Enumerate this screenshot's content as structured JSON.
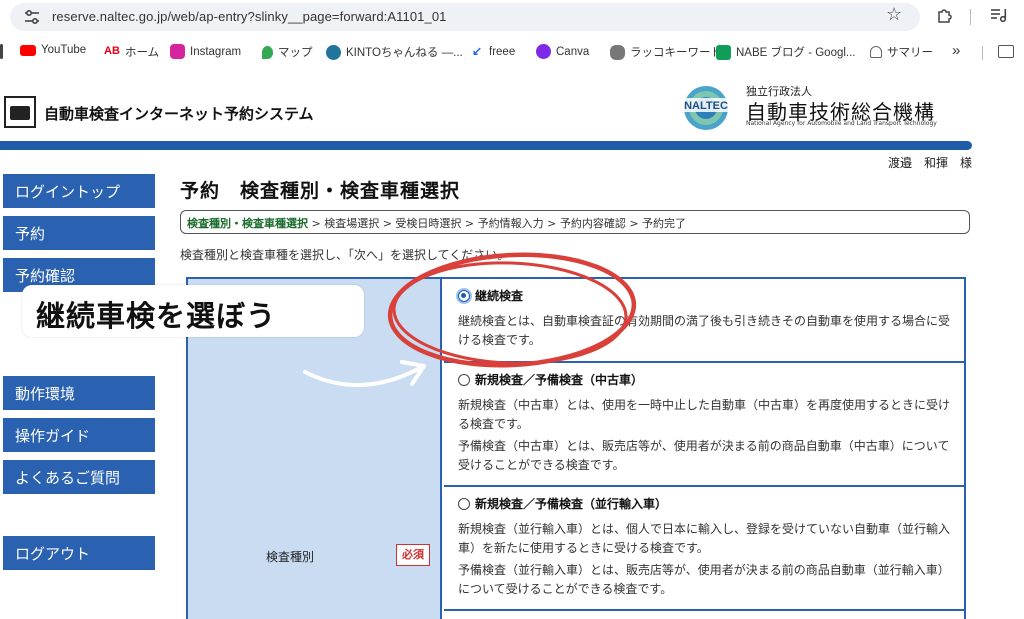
{
  "browser": {
    "url": "reserve.naltec.go.jp/web/ap-entry?slinky__page=forward:A1101_01",
    "bookmarks": [
      {
        "label": "YouTube",
        "icon": "youtube-icon",
        "color": "#ff0000"
      },
      {
        "label": "ホーム",
        "icon": "ab-logo-icon",
        "color": "#e60012"
      },
      {
        "label": "Instagram",
        "icon": "instagram-icon",
        "color": "#d6249f"
      },
      {
        "label": "マップ",
        "icon": "map-pin-icon",
        "color": "#34a853"
      },
      {
        "label": "KINTOちゃんねる —...",
        "icon": "wordpress-icon",
        "color": "#21759b"
      },
      {
        "label": "freee",
        "icon": "freee-icon",
        "color": "#2864f0"
      },
      {
        "label": "Canva",
        "icon": "canva-icon",
        "color": "#7d2ae8"
      },
      {
        "label": "ラッコキーワード",
        "icon": "rakko-icon",
        "color": "#444444"
      },
      {
        "label": "NABE ブログ - Googl...",
        "icon": "plus-icon",
        "color": "#0f9d58"
      },
      {
        "label": "サマリー",
        "icon": "summary-icon",
        "color": "#5f6368"
      }
    ],
    "more_label": "»"
  },
  "header": {
    "site_title": "自動車検査インターネット予約システム",
    "org_small": "独立行政法人",
    "org_big": "自動車技術総合機構",
    "org_en": "National Agency for Automobile and Land Transport Technology",
    "logo_text": "NALTEC",
    "user": "渡邉　和揮　様"
  },
  "sidebar": {
    "items": [
      {
        "label": "ログイントップ"
      },
      {
        "label": "予約"
      },
      {
        "label": "予約確認"
      },
      {
        "label": "動作環境"
      },
      {
        "label": "操作ガイド"
      },
      {
        "label": "よくあるご質問"
      },
      {
        "label": "ログアウト"
      }
    ]
  },
  "main": {
    "title": "予約　検査種別・検査車種選択",
    "steps": {
      "active": "検査種別・検査車種選択",
      "rest": " > 検査場選択 > 受検日時選択 > 予約情報入力 > 予約内容確認 > 予約完了"
    },
    "instructions": "検査種別と検査車種を選択し、「次へ」を選択してください。",
    "field_label": "検査種別",
    "required": "必須",
    "options": [
      {
        "title": "継続検査",
        "selected": true,
        "desc": [
          "継続検査とは、自動車検査証の有効期間の満了後も引き続きその自動車を使用する場合に受ける検査です。"
        ]
      },
      {
        "title": "新規検査／予備検査（中古車）",
        "selected": false,
        "desc": [
          "新規検査（中古車）とは、使用を一時中止した自動車（中古車）を再度使用するときに受ける検査です。",
          "予備検査（中古車）とは、販売店等が、使用者が決まる前の商品自動車（中古車）について受けることができる検査です。"
        ]
      },
      {
        "title": "新規検査／予備検査（並行輸入車）",
        "selected": false,
        "desc": [
          "新規検査（並行輸入車）とは、個人で日本に輸入し、登録を受けていない自動車（並行輸入車）を新たに使用するときに受ける検査です。",
          "予備検査（並行輸入車）とは、販売店等が、使用者が決まる前の商品自動車（並行輸入車）について受けることができる検査です。"
        ]
      }
    ]
  },
  "annotation": {
    "callout": "継続車検を選ぼう",
    "circle_color": "#d9403a"
  }
}
